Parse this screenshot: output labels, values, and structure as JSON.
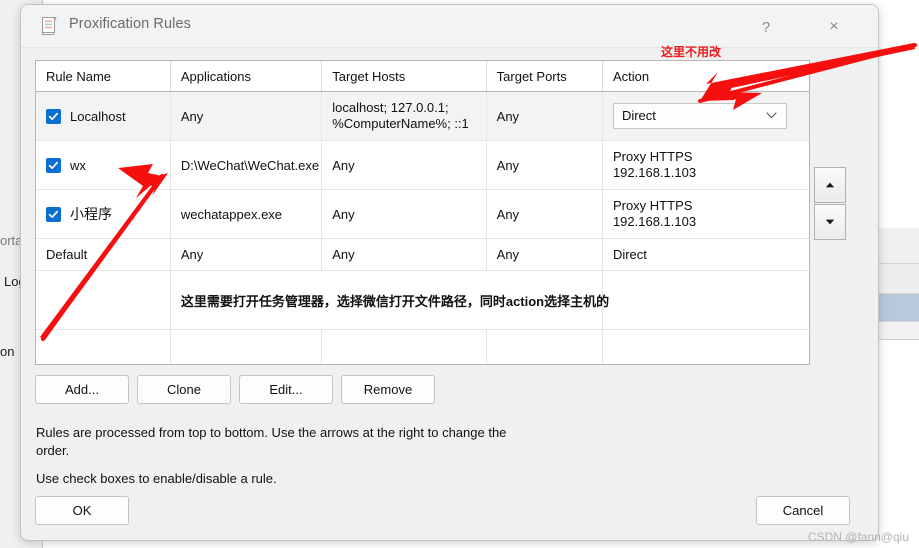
{
  "window": {
    "title": "Proxification Rules",
    "icon": "scroll-rules-icon",
    "help_label": "?",
    "close_label": "×"
  },
  "table": {
    "columns": [
      "Rule Name",
      "Applications",
      "Target Hosts",
      "Target Ports",
      "Action"
    ],
    "rows": [
      {
        "checked": true,
        "name": "Localhost",
        "applications": "Any",
        "target_hosts_line1": "localhost; 127.0.0.1;",
        "target_hosts_line2": "%ComputerName%; ::1",
        "target_ports": "Any",
        "action": "Direct",
        "action_is_dropdown": true
      },
      {
        "checked": true,
        "name": "wx",
        "applications": "D:\\WeChat\\WeChat.exe",
        "target_hosts_line1": "Any",
        "target_hosts_line2": "",
        "target_ports": "Any",
        "action_line1": "Proxy HTTPS",
        "action_line2": "192.168.1.103",
        "action_is_dropdown": false
      },
      {
        "checked": true,
        "name": "小程序",
        "applications": "wechatappex.exe",
        "target_hosts_line1": "Any",
        "target_hosts_line2": "",
        "target_ports": "Any",
        "action_line1": "Proxy HTTPS",
        "action_line2": "192.168.1.103",
        "action_is_dropdown": false
      },
      {
        "checked": false,
        "name": "Default",
        "applications": "Any",
        "target_hosts_line1": "Any",
        "target_hosts_line2": "",
        "target_ports": "Any",
        "action_line1": "Direct",
        "action_line2": "",
        "action_is_dropdown": false
      }
    ],
    "inline_note": "这里需要打开任务管理器，选择微信打开文件路径，同时action选择主机的"
  },
  "order_buttons": {
    "move_up": "move-up-arrow",
    "move_down": "move-down-arrow"
  },
  "buttons": {
    "add": "Add...",
    "clone": "Clone",
    "edit": "Edit...",
    "remove": "Remove",
    "ok": "OK",
    "cancel": "Cancel"
  },
  "help": {
    "line1": "Rules are processed from top to bottom. Use the arrows at the right to change the order.",
    "line2": "Use check boxes to enable/disable a rule."
  },
  "annotations": {
    "top_right": "这里不用改"
  },
  "background": {
    "fragment_1": "orta",
    "fragment_2": "Log",
    "fragment_3": "on"
  },
  "watermark": "CSDN @fann@qiu",
  "colors": {
    "accent_checkbox": "#0a6fd3",
    "annotation_red": "#ee1d1d",
    "dialog_bg": "#f0f0f0",
    "titlebar_bg": "#f2f3f5"
  }
}
